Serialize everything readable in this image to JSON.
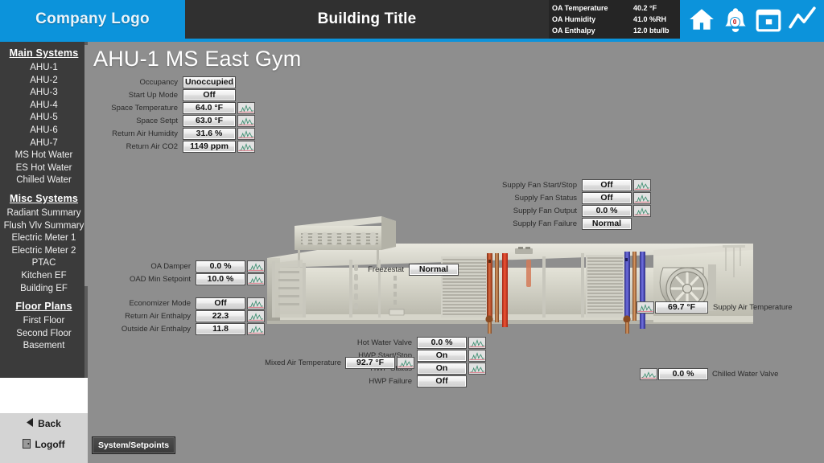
{
  "header": {
    "logo": "Company Logo",
    "building_title": "Building Title",
    "oa": [
      {
        "label": "OA Temperature",
        "value": "40.2 °F"
      },
      {
        "label": "OA Humidity",
        "value": "41.0 %RH"
      },
      {
        "label": "OA Enthalpy",
        "value": "12.0 btu/lb"
      }
    ],
    "icons": {
      "home": "home-icon",
      "alarm": "alarm-bell-icon",
      "alarm_count": "0",
      "calendar": "calendar-icon",
      "trend": "trend-chart-icon"
    },
    "accent_color": "#0c93db",
    "title_bg": "#303030"
  },
  "sidebar": {
    "groups": [
      {
        "heading": "Main Systems",
        "items": [
          "AHU-1",
          "AHU-2",
          "AHU-3",
          "AHU-4",
          "AHU-5",
          "AHU-6",
          "AHU-7",
          "MS Hot Water",
          "ES Hot Water",
          "Chilled Water"
        ]
      },
      {
        "heading": "Misc Systems",
        "items": [
          "Radiant Summary",
          "Flush Vlv Summary",
          "Electric Meter 1",
          "Electric Meter 2",
          "PTAC",
          "Kitchen EF",
          "Building EF"
        ]
      },
      {
        "heading": "Floor Plans",
        "items": [
          "First Floor",
          "Second Floor",
          "Basement"
        ]
      }
    ],
    "footer": {
      "back": "Back",
      "logoff": "Logoff"
    }
  },
  "main": {
    "page_title": "AHU-1 MS East Gym",
    "bottom_button": "System/Setpoints",
    "status_panel": [
      {
        "label": "Occupancy",
        "value": "Unoccupied",
        "trend": false
      },
      {
        "label": "Start Up Mode",
        "value": "Off",
        "trend": false
      },
      {
        "label": "Space Temperature",
        "value": "64.0 °F",
        "trend": true
      },
      {
        "label": "Space Setpt",
        "value": "63.0 °F",
        "trend": true
      },
      {
        "label": "Return Air Humidity",
        "value": "31.6 %",
        "trend": true
      },
      {
        "label": "Return Air CO2",
        "value": "1149 ppm",
        "trend": true
      }
    ],
    "supply_fan_panel": [
      {
        "label": "Supply Fan Start/Stop",
        "value": "Off",
        "trend": true
      },
      {
        "label": "Supply Fan Status",
        "value": "Off",
        "trend": true
      },
      {
        "label": "Supply Fan Output",
        "value": "0.0 %",
        "trend": true
      },
      {
        "label": "Supply Fan Failure",
        "value": "Normal",
        "trend": false
      }
    ],
    "damper_panel": [
      {
        "label": "OA Damper",
        "value": "0.0 %",
        "trend": true
      },
      {
        "label": "OAD Min Setpoint",
        "value": "10.0 %",
        "trend": true
      }
    ],
    "economizer_panel": [
      {
        "label": "Economizer Mode",
        "value": "Off",
        "trend": true
      },
      {
        "label": "Return Air Enthalpy",
        "value": "22.3",
        "trend": true
      },
      {
        "label": "Outside Air Enthalpy",
        "value": "11.8",
        "trend": true
      }
    ],
    "hot_water_panel": [
      {
        "label": "Hot Water Valve",
        "value": "0.0 %",
        "trend": true
      },
      {
        "label": "HWP Start/Stop",
        "value": "On",
        "trend": true
      },
      {
        "label": "HWP Status",
        "value": "On",
        "trend": true
      },
      {
        "label": "HWP Failure",
        "value": "Off",
        "trend": false
      }
    ],
    "freezestat": {
      "label": "Freezestat",
      "value": "Normal"
    },
    "mixed_air": {
      "label": "Mixed Air Temperature",
      "value": "92.7 °F"
    },
    "chilled_water_valve": {
      "label": "Chilled Water Valve",
      "value": "0.0 %"
    },
    "supply_air_temp": {
      "label": "Supply Air Temperature",
      "value": "69.7 °F"
    }
  }
}
